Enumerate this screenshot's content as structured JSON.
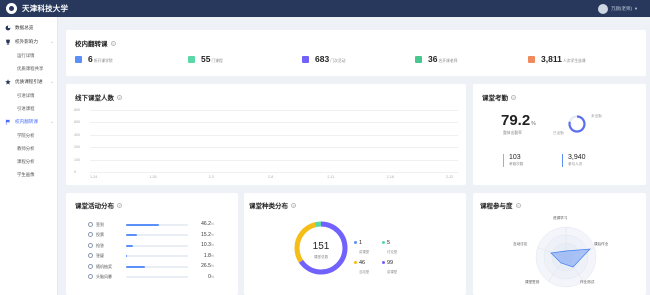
{
  "header": {
    "title": "天津科技大学",
    "user": "万颜(老师)"
  },
  "sidebar": {
    "groups": [
      {
        "label": "数据总览",
        "subs": []
      },
      {
        "label": "校外影响力",
        "subs": [
          "运行详情",
          "优质课程共享"
        ]
      },
      {
        "label": "优质课程引进",
        "subs": [
          "引进详情",
          "引进课程"
        ]
      },
      {
        "label": "校内翻转课",
        "subs": [
          "学院分析",
          "教师分析",
          "课程分析",
          "学生画像"
        ]
      }
    ]
  },
  "flip": {
    "title": "校内翻转课",
    "stats": [
      {
        "value": "6",
        "unit": "所开课学院"
      },
      {
        "value": "55",
        "unit": "门课程"
      },
      {
        "value": "683",
        "unit": "门次活动"
      },
      {
        "value": "36",
        "unit": "名开课老师"
      },
      {
        "value": "3,811",
        "unit": "人次学生选课"
      }
    ]
  },
  "offline": {
    "title": "线下课堂人数",
    "chart_data": {
      "type": "line",
      "x": [
        "1-24",
        "1-26",
        "2-3",
        "2-8",
        "2-11",
        "2-16",
        "2-22"
      ],
      "series": [],
      "ylabels": [
        "800",
        "600",
        "400",
        "200",
        "100",
        "0"
      ]
    }
  },
  "attendance": {
    "title": "课堂考勤",
    "rate": "79.2",
    "rate_unit": "%",
    "rate_label": "整体出勤率",
    "ring_label_absent": "未出勤",
    "ring_label_present": "已出勤",
    "ring_fraction": 0.792,
    "count_value": "103",
    "count_label": "考勤次数",
    "people_value": "3,940",
    "people_label": "参与人次"
  },
  "activity": {
    "title": "课堂活动分布",
    "items": [
      {
        "label": "签到",
        "value": "46.2",
        "fraction": 0.462
      },
      {
        "label": "投票",
        "value": "15.2",
        "fraction": 0.152
      },
      {
        "label": "抢答",
        "value": "10.3",
        "fraction": 0.103
      },
      {
        "label": "答疑",
        "value": "1.8",
        "fraction": 0.018
      },
      {
        "label": "随机抽奖",
        "value": "26.5",
        "fraction": 0.265
      },
      {
        "label": "头脑风暴",
        "value": "0",
        "fraction": 0
      }
    ],
    "unit": "%"
  },
  "category": {
    "title": "课堂种类分布",
    "total": "151",
    "total_label": "课堂总数",
    "legend": [
      {
        "value": "1",
        "label": "讲课型",
        "color": "#5b8ff9"
      },
      {
        "value": "5",
        "label": "讨论型",
        "color": "#5ad8a6"
      },
      {
        "value": "46",
        "label": "互动型",
        "color": "#f6bd16"
      },
      {
        "value": "99",
        "label": "讲课型",
        "color": "#7262fd"
      }
    ]
  },
  "participation": {
    "title": "课程参与度",
    "axes": [
      "资源学习",
      "课后作业",
      "作业测试",
      "课堂签到",
      "互动讨论"
    ]
  },
  "colors": {
    "accent": "#4a6cf7",
    "nav": "#27385c"
  }
}
